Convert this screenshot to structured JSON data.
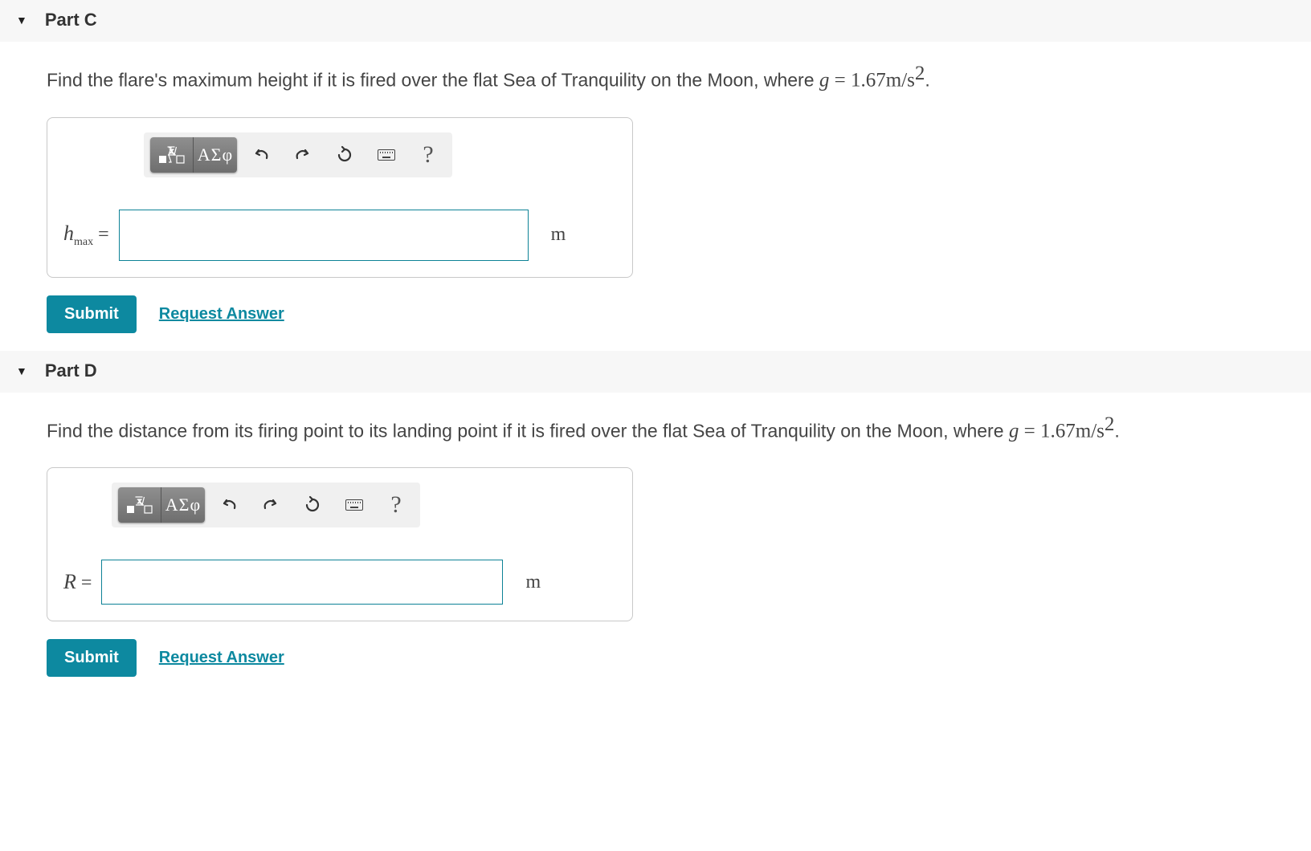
{
  "parts": {
    "c": {
      "title": "Part C",
      "prompt_pre": "Find the flare's maximum height if it is fired over the flat Sea of Tranquility on the Moon, where ",
      "prompt_var": "g",
      "prompt_eq": " = ",
      "prompt_val": "1.67m/s",
      "prompt_exp": "2",
      "prompt_post": ".",
      "label_main": "h",
      "label_sub": "max",
      "eq": " = ",
      "unit": "m"
    },
    "d": {
      "title": "Part D",
      "prompt_pre": "Find the distance from its firing point to its landing point if it is fired over the flat Sea of Tranquility on the Moon, where ",
      "prompt_var": "g",
      "prompt_eq": " = ",
      "prompt_val": "1.67m/s",
      "prompt_exp": "2",
      "prompt_post": ".",
      "label_main": "R",
      "eq": " = ",
      "unit": "m"
    }
  },
  "toolbar": {
    "greek_label": "ΑΣφ",
    "help": "?"
  },
  "actions": {
    "submit": "Submit",
    "request": "Request Answer"
  }
}
